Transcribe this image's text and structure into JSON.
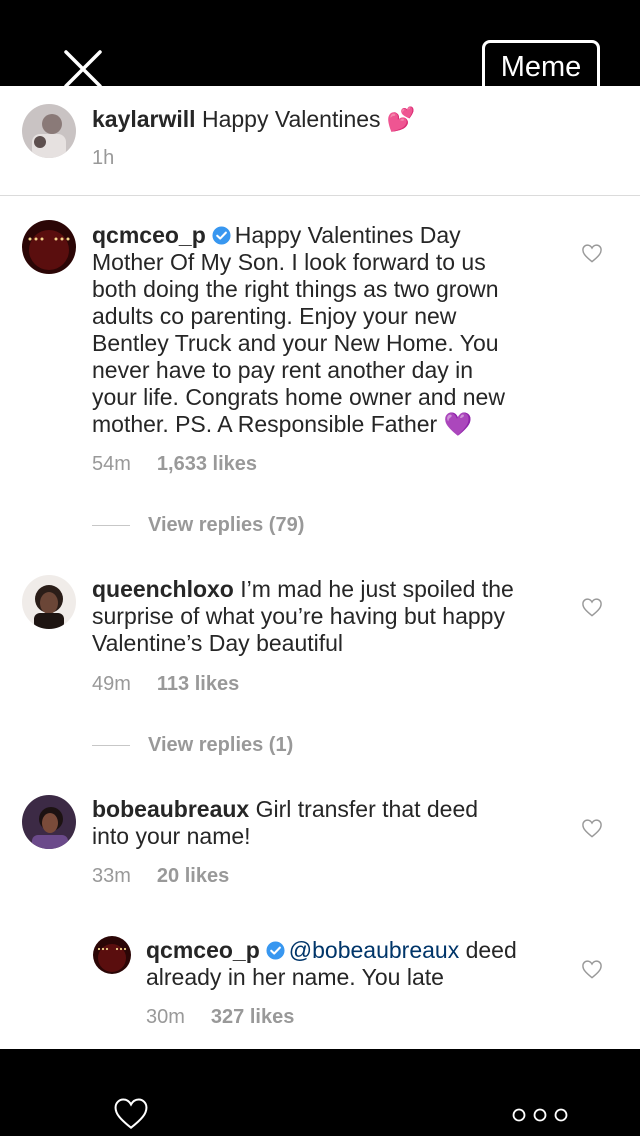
{
  "topbar": {
    "close_icon": "close-icon",
    "meme_label": "Meme"
  },
  "header_comment": {
    "username": "kaylarwill",
    "text": "Happy Valentines 💕",
    "time": "1h"
  },
  "comments": [
    {
      "username": "qcmceo_p",
      "verified": true,
      "lines": [
        "Happy Valentines Day",
        "Mother Of My Son. I look forward to us",
        "both doing the right things as two grown",
        "adults co parenting. Enjoy your new",
        "Bentley Truck and your New Home. You",
        "never have to pay rent another day in",
        "your life. Congrats home owner and new",
        "mother. PS. A Responsible Father 💜"
      ],
      "time": "54m",
      "likes": "1,633 likes",
      "view_replies": "View replies (79)"
    },
    {
      "username": "queenchloxo",
      "verified": false,
      "lines": [
        "I’m mad he just spoiled the",
        "surprise of what you’re having but happy",
        "Valentine’s Day beautiful"
      ],
      "time": "49m",
      "likes": "113 likes",
      "view_replies": "View replies (1)"
    },
    {
      "username": "bobeaubreaux",
      "verified": false,
      "lines": [
        "Girl transfer that deed",
        "into your name!"
      ],
      "time": "33m",
      "likes": "20 likes"
    }
  ],
  "reply": {
    "username": "qcmceo_p",
    "verified": true,
    "mention": "@bobeaubreaux",
    "lines": [
      "deed",
      "already in her name. You late"
    ],
    "time": "30m",
    "likes": "327 likes"
  },
  "bottombar": {
    "like_icon": "heart-outline-icon",
    "more_icon": "more-dots-icon"
  },
  "colors": {
    "verified_blue": "#3897f0",
    "mention_blue": "#003569",
    "meta_gray": "#999999"
  }
}
